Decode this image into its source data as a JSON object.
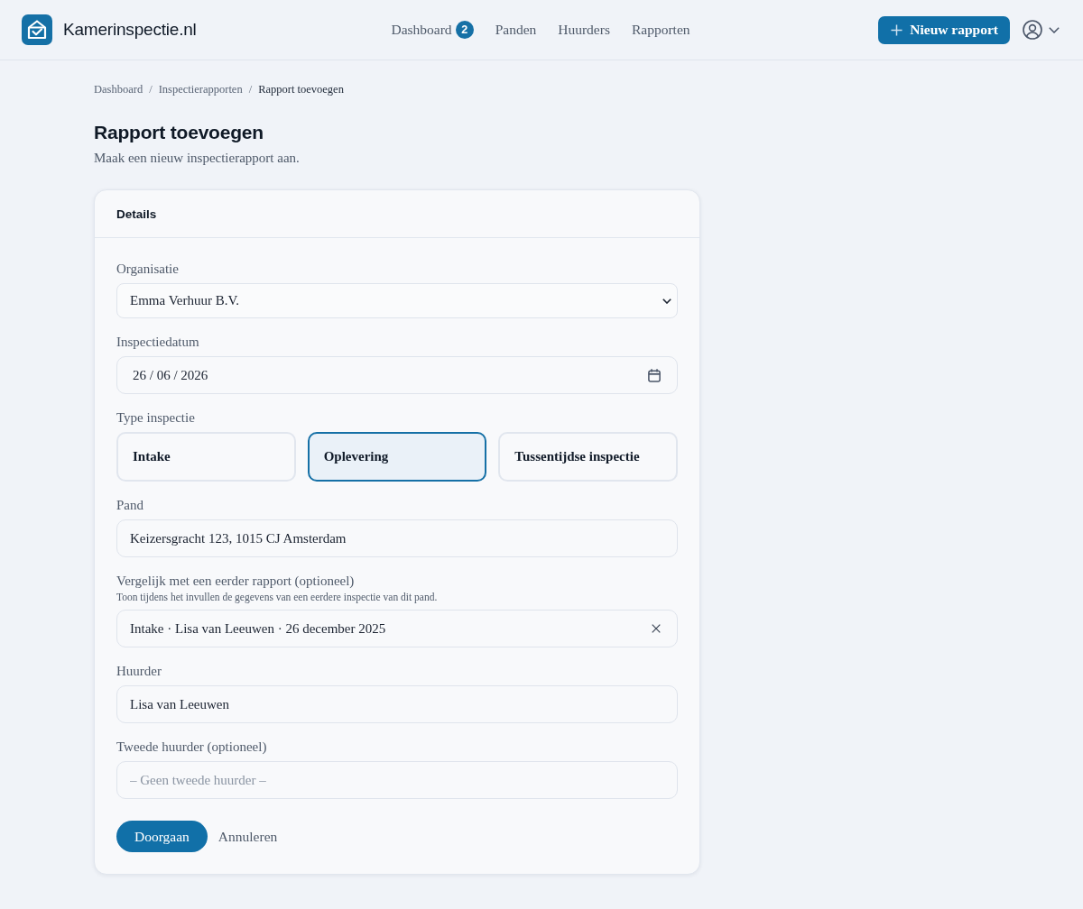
{
  "header": {
    "brand": "Kamerinspectie.nl",
    "nav": [
      {
        "label": "Dashboard",
        "badge": "2",
        "selected": false
      },
      {
        "label": "Panden",
        "selected": false
      },
      {
        "label": "Huurders",
        "selected": false
      },
      {
        "label": "Rapporten",
        "selected": false
      }
    ],
    "new_button": "Nieuw rapport"
  },
  "breadcrumb": [
    {
      "label": "Dashboard",
      "separator": "/",
      "current": false
    },
    {
      "label": "Inspectierapporten",
      "separator": "/",
      "current": false
    },
    {
      "label": "Rapport toevoegen",
      "current": true
    }
  ],
  "page": {
    "title": "Rapport toevoegen",
    "subtitle": "Maak een nieuw inspectierapport aan."
  },
  "card": {
    "title": "Details",
    "fields": [
      {
        "kind": "select",
        "label": "Organisatie",
        "value": "Emma Verhuur B.V."
      },
      {
        "kind": "date",
        "label": "Inspectiedatum",
        "value": "26 / 06 / 2026"
      },
      {
        "kind": "choice",
        "label": "Type inspectie",
        "options": [
          {
            "label": "Intake",
            "selected": false
          },
          {
            "label": "Oplevering",
            "selected": true
          },
          {
            "label": "Tussentijdse inspectie",
            "selected": false
          }
        ]
      },
      {
        "kind": "text",
        "label": "Pand",
        "value": "Keizersgracht 123, 1015 CJ Amsterdam"
      },
      {
        "kind": "clearable",
        "label": "Vergelijk met een eerder rapport (optioneel)",
        "hint": "Toon tijdens het invullen de gegevens van een eerdere inspectie van dit pand.",
        "value": "Intake · Lisa van Leeuwen · 26 december 2025"
      },
      {
        "kind": "text",
        "label": "Huurder",
        "value": "Lisa van Leeuwen"
      },
      {
        "kind": "text",
        "label": "Tweede huurder (optioneel)",
        "placeholder": "– Geen tweede huurder –"
      }
    ],
    "actions": {
      "primary": "Doorgaan",
      "secondary": "Annuleren"
    }
  }
}
